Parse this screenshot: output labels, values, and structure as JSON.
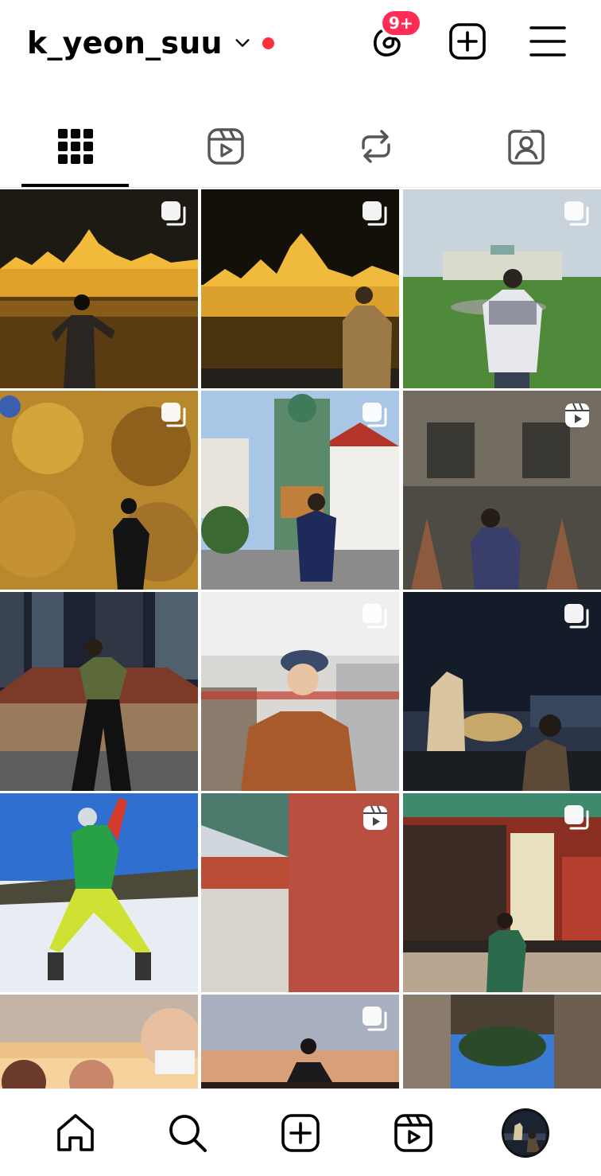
{
  "header": {
    "username": "k_yeon_suu",
    "notification_badge": "9+",
    "icons": [
      "chevron-down-icon",
      "threads-icon",
      "new-post-icon",
      "menu-icon"
    ],
    "live_dot_color": "#ff2d3a",
    "badge_color": "#ff2d55"
  },
  "tabs": [
    {
      "name": "posts",
      "icon": "grid-icon",
      "active": true
    },
    {
      "name": "reels",
      "icon": "reels-icon",
      "active": false
    },
    {
      "name": "reposts",
      "icon": "repost-icon",
      "active": false
    },
    {
      "name": "tagged",
      "icon": "tagged-icon",
      "active": false
    }
  ],
  "posts": [
    {
      "type": "carousel",
      "scene": "parliament-night-1"
    },
    {
      "type": "carousel",
      "scene": "parliament-night-2"
    },
    {
      "type": "carousel",
      "scene": "palace-lawn"
    },
    {
      "type": "carousel",
      "scene": "graffiti-wall"
    },
    {
      "type": "carousel",
      "scene": "temple-giant"
    },
    {
      "type": "reel",
      "scene": "temple-spires"
    },
    {
      "type": "none",
      "scene": "night-market"
    },
    {
      "type": "carousel",
      "scene": "hat-shop"
    },
    {
      "type": "carousel",
      "scene": "merlion-night"
    },
    {
      "type": "none",
      "scene": "ski-slope"
    },
    {
      "type": "reel",
      "scene": "red-pillar"
    },
    {
      "type": "carousel",
      "scene": "palace-gate"
    },
    {
      "type": "none",
      "scene": "sunset-selfie"
    },
    {
      "type": "carousel",
      "scene": "sunset-silhouette"
    },
    {
      "type": "none",
      "scene": "stone-arch"
    }
  ],
  "bottom_nav": [
    "home-icon",
    "search-icon",
    "create-icon",
    "reels-icon",
    "profile-avatar"
  ]
}
